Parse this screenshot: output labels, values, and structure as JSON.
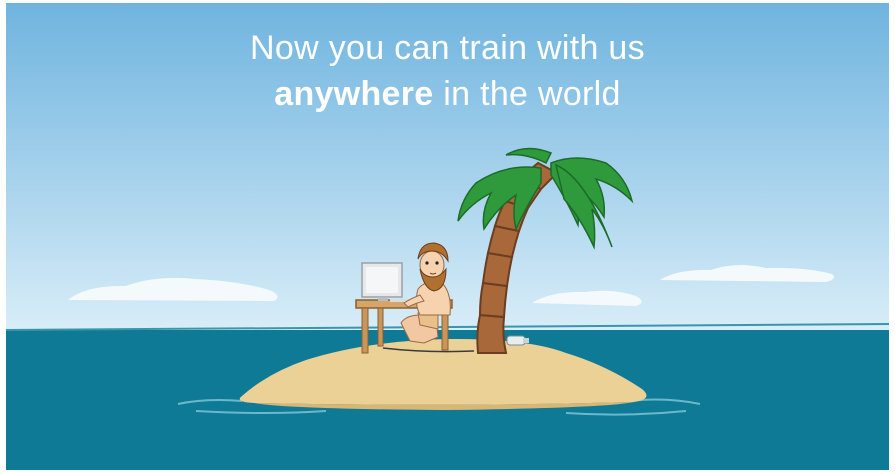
{
  "headline": {
    "line1": "Now you can train with us",
    "line2_bold": "anywhere",
    "line2_rest": " in the world"
  },
  "colors": {
    "sky_top": "#73b6e0",
    "sky_bottom": "#d6ebf7",
    "sea": "#0f7a95",
    "sand": "#ecd197",
    "palm_leaf": "#2f9a3c",
    "trunk": "#a8683a"
  },
  "scene": {
    "elements": [
      "clouds",
      "sea",
      "island",
      "palm-tree",
      "desk",
      "computer-monitor",
      "bearded-man",
      "bottle"
    ]
  }
}
